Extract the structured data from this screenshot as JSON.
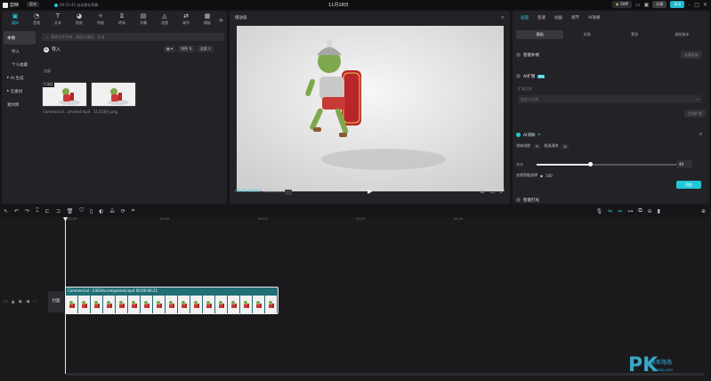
{
  "titlebar": {
    "app_name": "剪映",
    "menu_label": "菜单",
    "autosave_text": "00:52:45 自动保存草稿",
    "project_title": "11月18日",
    "svip_label": "SVIP",
    "share_label": "分享",
    "export_label": "导出"
  },
  "tools": [
    {
      "icon": "media-icon",
      "label": "媒体",
      "active": true
    },
    {
      "icon": "audio-icon",
      "label": "音频"
    },
    {
      "icon": "text-icon",
      "label": "文本"
    },
    {
      "icon": "sticker-icon",
      "label": "贴纸"
    },
    {
      "icon": "effects-icon",
      "label": "特效"
    },
    {
      "icon": "transition-icon",
      "label": "转场"
    },
    {
      "icon": "subtitle-icon",
      "label": "字幕"
    },
    {
      "icon": "filter-icon",
      "label": "滤镜"
    },
    {
      "icon": "adjust-icon",
      "label": "调节"
    },
    {
      "icon": "template-icon",
      "label": "模板"
    }
  ],
  "leftnav": {
    "items": [
      {
        "label": "本地",
        "active": true
      },
      {
        "label": "导入",
        "sub": true
      },
      {
        "label": "个人收藏",
        "sub": true
      },
      {
        "label": "AI 生成"
      },
      {
        "label": "云素材"
      },
      {
        "label": "素材库"
      }
    ]
  },
  "media": {
    "search_placeholder": "搜索文件名称、画面关键词、台词",
    "import_label": "导入",
    "sort_label": "排序",
    "filter_label": "全部",
    "all_label": "全部",
    "items": [
      {
        "name": "Commercial...omated.mp4",
        "badge": "已添加"
      },
      {
        "name": "11月18日.png"
      }
    ]
  },
  "player": {
    "title": "播放器",
    "current_time": "00:00:00:00",
    "total_time": "00:00:06:21"
  },
  "inspector": {
    "tabs": [
      "画面",
      "变速",
      "动画",
      "调节",
      "AI效果"
    ],
    "active_tab": "画面",
    "subtabs": [
      "基础",
      "抠像",
      "蒙版",
      "美颜美体"
    ],
    "active_subtab": "基础",
    "sections": {
      "s1_label": "智能补帧",
      "s1_button": "去重复帧",
      "s2_label": "AI扩图",
      "s2_badge": "限免",
      "s2_field_label": "扩展比例",
      "s2_select": "自定义比例",
      "s2_button": "生成扩图",
      "s3_label": "AI消除",
      "s3_brush": "涂抹消除",
      "s3_box": "框选消除",
      "size_label": "大小",
      "size_value": "40",
      "remove_label": "去除智能选择",
      "remove_value": "100",
      "apply_label": "消除",
      "s4_label": "智能打光"
    }
  },
  "timeline": {
    "ruler": [
      "00:00",
      "00:05",
      "00:10",
      "00:15",
      "00:20"
    ],
    "cover_label": "封面",
    "clip_label": "Commercial - 2403Accompanied.mp4   00:00:06:21"
  },
  "watermark": {
    "brand": "PK",
    "site_cn": "侯斯路路",
    "site_en": "pkstep.com"
  }
}
